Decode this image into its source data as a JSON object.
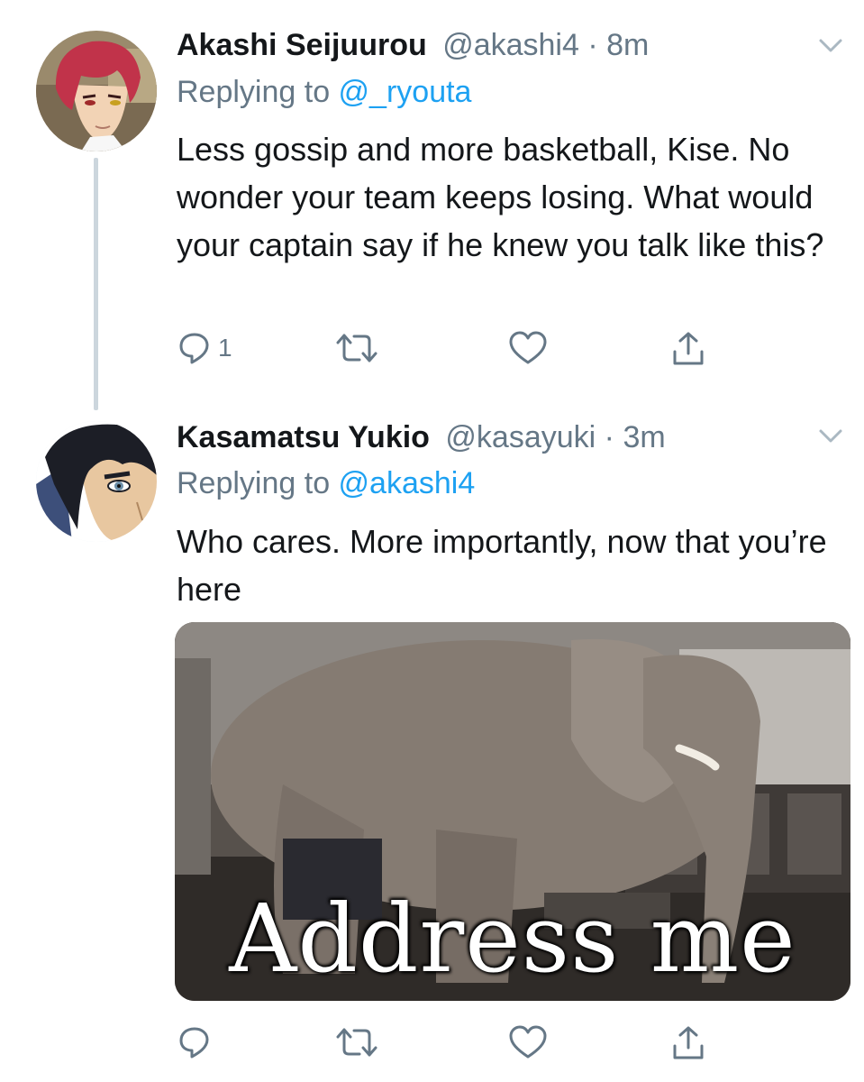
{
  "tweets": [
    {
      "name": "Akashi Seijuurou",
      "handle": "@akashi4",
      "dot": "·",
      "time": "8m",
      "replying_prefix": "Replying to ",
      "replying_to": "@_ryouta",
      "text": "Less gossip and more basketball, Kise. No wonder your team keeps losing. What would your captain say if he knew you talk like this?",
      "reply_count": "1",
      "avatar_icon": "avatar-red-hair",
      "colors": {
        "hair": "#c1334a"
      }
    },
    {
      "name": "Kasamatsu Yukio",
      "handle": "@kasayuki",
      "dot": "·",
      "time": "3m",
      "replying_prefix": "Replying to ",
      "replying_to": "@akashi4",
      "text": "Who cares. More importantly, now that you’re here",
      "reply_count": "",
      "avatar_icon": "avatar-dark-hair",
      "media_caption": "Address me",
      "colors": {
        "hair": "#1c1e26"
      }
    }
  ],
  "icons": [
    "reply-icon",
    "retweet-icon",
    "like-icon",
    "share-icon",
    "chevron-down-icon"
  ],
  "colors": {
    "text": "#14171a",
    "muted": "#657786",
    "link": "#1da1f2",
    "thread": "#ccd6dd"
  }
}
